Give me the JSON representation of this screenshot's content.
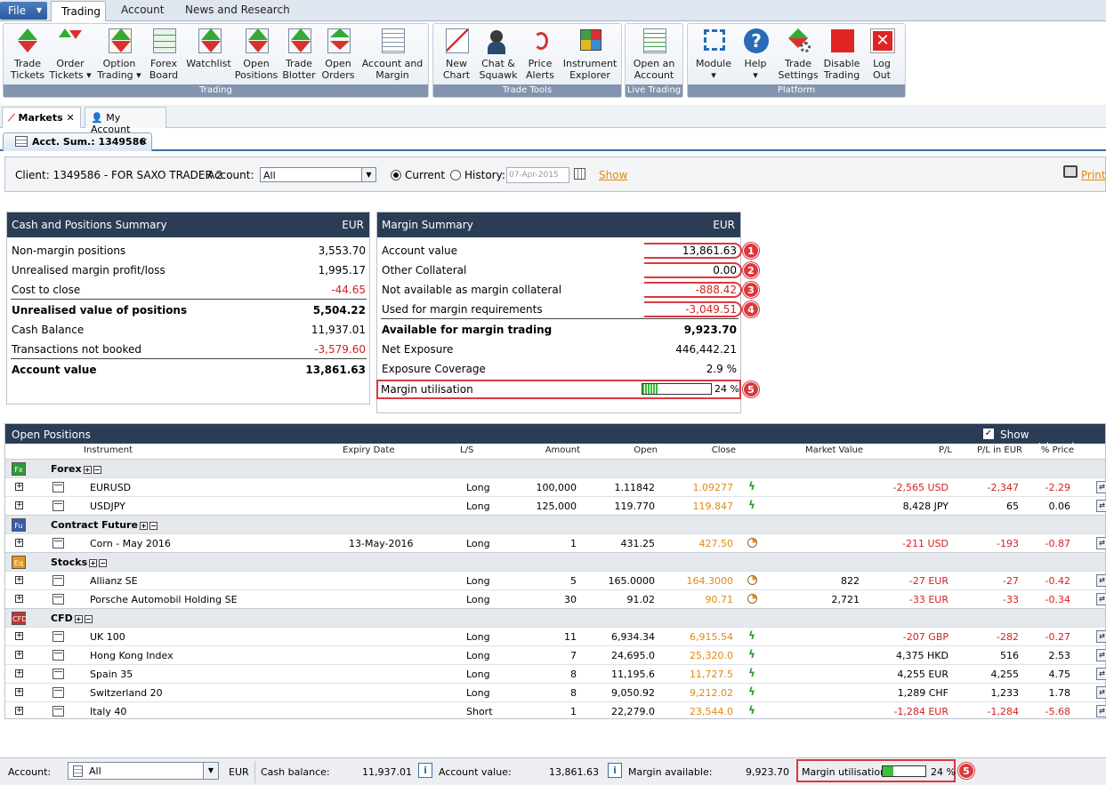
{
  "menubar": {
    "file": "File",
    "tabs": [
      "Trading",
      "Account",
      "News and Research"
    ]
  },
  "ribbon": {
    "groups": [
      "Trading",
      "Trade Tools",
      "Live Trading",
      "Platform"
    ],
    "buttons": {
      "trade_tickets": [
        "Trade",
        "Tickets"
      ],
      "order_tickets": [
        "Order",
        "Tickets ▾"
      ],
      "option_trading": [
        "Option",
        "Trading ▾"
      ],
      "forex_board": [
        "Forex",
        "Board"
      ],
      "watchlist": [
        "Watchlist",
        ""
      ],
      "open_positions": [
        "Open",
        "Positions"
      ],
      "trade_blotter": [
        "Trade",
        "Blotter"
      ],
      "open_orders": [
        "Open",
        "Orders"
      ],
      "account_margin": [
        "Account and",
        "Margin"
      ],
      "new_chart": [
        "New",
        "Chart"
      ],
      "chat_squawk": [
        "Chat &",
        "Squawk"
      ],
      "price_alerts": [
        "Price",
        "Alerts"
      ],
      "instrument_explorer": [
        "Instrument",
        "Explorer"
      ],
      "open_account": [
        "Open an",
        "Account"
      ],
      "module": [
        "Module",
        "▾"
      ],
      "help": [
        "Help",
        "▾"
      ],
      "trade_settings": [
        "Trade",
        "Settings"
      ],
      "disable_trading": [
        "Disable",
        "Trading"
      ],
      "log_out": [
        "Log",
        "Out"
      ]
    }
  },
  "tabs": {
    "markets": "Markets",
    "my_account": "My Account",
    "acct_sum": "Acct. Sum.: 1349586"
  },
  "client": {
    "client_label": "Client: 1349586 - FOR SAXO TRADER 2",
    "account_label": "Account:",
    "account_value": "All",
    "current": "Current",
    "history": "History:",
    "date": "07-Apr-2015",
    "show": "Show",
    "print": "Print"
  },
  "cash": {
    "title": "Cash and Positions Summary",
    "currency": "EUR",
    "rows": [
      {
        "label": "Non-margin positions",
        "value": "3,553.70"
      },
      {
        "label": "Unrealised margin profit/loss",
        "value": "1,995.17"
      },
      {
        "label": "Cost to close",
        "value": "-44.65"
      },
      {
        "label": "Unrealised value of positions",
        "value": "5,504.22"
      },
      {
        "label": "Cash Balance",
        "value": "11,937.01"
      },
      {
        "label": "Transactions not booked",
        "value": "-3,579.60"
      },
      {
        "label": "Account value",
        "value": "13,861.63"
      }
    ]
  },
  "margin": {
    "title": "Margin Summary",
    "currency": "EUR",
    "rows": [
      {
        "label": "Account value",
        "value": "13,861.63",
        "badge": "1"
      },
      {
        "label": "Other Collateral",
        "value": "0.00",
        "badge": "2"
      },
      {
        "label": "Not available as margin collateral",
        "value": "-888.42",
        "badge": "3"
      },
      {
        "label": "Used for margin requirements",
        "value": "-3,049.51",
        "badge": "4"
      },
      {
        "label": "Available for margin trading",
        "value": "9,923.70"
      },
      {
        "label": "Net Exposure",
        "value": "446,442.21"
      },
      {
        "label": "Exposure Coverage",
        "value": "2.9 %"
      }
    ],
    "utilisation_label": "Margin utilisation",
    "utilisation_value": "24 %",
    "utilisation_fraction": 0.24,
    "badge5": "5"
  },
  "positions": {
    "title": "Open Positions",
    "show_closed": "Show square/closed",
    "columns": [
      "Instrument",
      "Expiry Date",
      "L/S",
      "Amount",
      "Open",
      "Close",
      "Market Value",
      "P/L",
      "P/L in EUR",
      "% Price"
    ],
    "groups": [
      {
        "icon": "Fx",
        "name": "Forex",
        "color": "#2e9a3a",
        "rows": [
          {
            "instrument": "EURUSD",
            "expiry": "",
            "ls": "Long",
            "amount": "100,000",
            "open": "1.11842",
            "close": "1.09277",
            "mv": "",
            "pl": "-2,565 USD",
            "pleur": "-2,347",
            "pct": "-2.29",
            "icon": "bolt"
          },
          {
            "instrument": "USDJPY",
            "expiry": "",
            "ls": "Long",
            "amount": "125,000",
            "open": "119.770",
            "close": "119.847",
            "mv": "",
            "pl": "8,428 JPY",
            "pleur": "65",
            "pct": "0.06",
            "icon": "bolt"
          }
        ]
      },
      {
        "icon": "Fu",
        "name": "Contract Future",
        "color": "#3a5da8",
        "rows": [
          {
            "instrument": "Corn - May 2016",
            "expiry": "13-May-2016",
            "ls": "Long",
            "amount": "1",
            "open": "431.25",
            "close": "427.50",
            "mv": "",
            "pl": "-211 USD",
            "pleur": "-193",
            "pct": "-0.87",
            "icon": "clock"
          }
        ]
      },
      {
        "icon": "Eq",
        "name": "Stocks",
        "color": "#e8951a",
        "rows": [
          {
            "instrument": "Allianz SE",
            "expiry": "",
            "ls": "Long",
            "amount": "5",
            "open": "165.0000",
            "close": "164.3000",
            "mv": "822",
            "pl": "-27 EUR",
            "pleur": "-27",
            "pct": "-0.42",
            "icon": "clock"
          },
          {
            "instrument": "Porsche Automobil Holding SE",
            "expiry": "",
            "ls": "Long",
            "amount": "30",
            "open": "91.02",
            "close": "90.71",
            "mv": "2,721",
            "pl": "-33 EUR",
            "pleur": "-33",
            "pct": "-0.34",
            "icon": "clock"
          }
        ]
      },
      {
        "icon": "CFD",
        "name": "CFD",
        "color": "#c43030",
        "rows": [
          {
            "instrument": "UK 100",
            "expiry": "",
            "ls": "Long",
            "amount": "11",
            "open": "6,934.34",
            "close": "6,915.54",
            "mv": "",
            "pl": "-207 GBP",
            "pleur": "-282",
            "pct": "-0.27",
            "icon": "bolt"
          },
          {
            "instrument": "Hong Kong Index",
            "expiry": "",
            "ls": "Long",
            "amount": "7",
            "open": "24,695.0",
            "close": "25,320.0",
            "mv": "",
            "pl": "4,375 HKD",
            "pleur": "516",
            "pct": "2.53",
            "icon": "bolt"
          },
          {
            "instrument": "Spain 35",
            "expiry": "",
            "ls": "Long",
            "amount": "8",
            "open": "11,195.6",
            "close": "11,727.5",
            "mv": "",
            "pl": "4,255 EUR",
            "pleur": "4,255",
            "pct": "4.75",
            "icon": "bolt"
          },
          {
            "instrument": "Switzerland 20",
            "expiry": "",
            "ls": "Long",
            "amount": "8",
            "open": "9,050.92",
            "close": "9,212.02",
            "mv": "",
            "pl": "1,289 CHF",
            "pleur": "1,233",
            "pct": "1.78",
            "icon": "bolt"
          },
          {
            "instrument": "Italy 40",
            "expiry": "",
            "ls": "Short",
            "amount": "1",
            "open": "22,279.0",
            "close": "23,544.0",
            "mv": "",
            "pl": "-1,284 EUR",
            "pleur": "-1,284",
            "pct": "-5.68",
            "icon": "bolt"
          }
        ]
      }
    ]
  },
  "status": {
    "account_label": "Account:",
    "account_value": "All",
    "currency": "EUR",
    "cash_label": "Cash balance:",
    "cash_value": "11,937.01",
    "acct_value_label": "Account value:",
    "acct_value": "13,861.63",
    "margin_avail_label": "Margin available:",
    "margin_avail": "9,923.70",
    "util_label": "Margin utilisation:",
    "util_value": "24 %",
    "util_fraction": 0.24,
    "badge": "5"
  }
}
